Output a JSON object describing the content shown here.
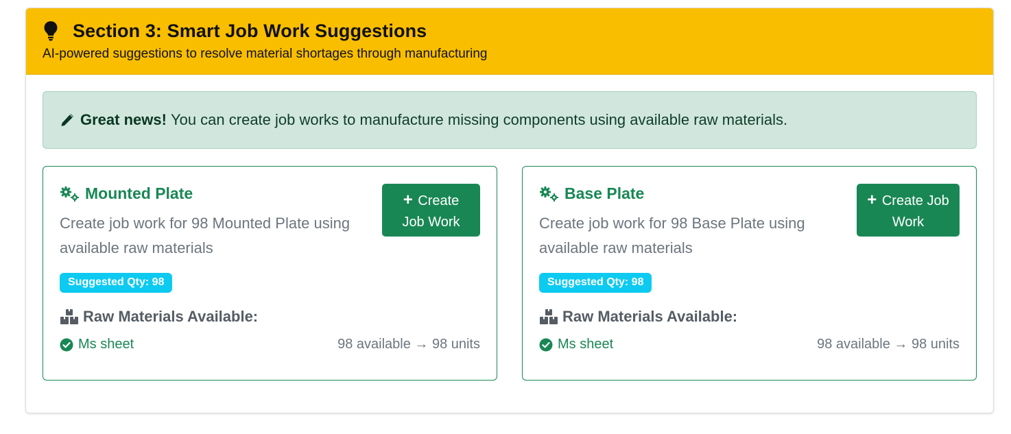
{
  "section": {
    "title": "Section 3: Smart Job Work Suggestions",
    "subtitle": "AI-powered suggestions to resolve material shortages through manufacturing",
    "icon": "lightbulb-icon",
    "header_color": "#f9be00"
  },
  "alert": {
    "strong": "Great news!",
    "message": "You can create job works to manufacture missing components using available raw materials.",
    "icon": "pencil-icon"
  },
  "cards": [
    {
      "title": "Mounted Plate",
      "description": "Create job work for 98 Mounted Plate using available raw materials",
      "button_plus": "+",
      "button_label": "Create Job Work",
      "badge": "Suggested Qty: 98",
      "raw_title": "Raw Materials Available:",
      "materials": [
        {
          "name": "Ms sheet",
          "qty": "98 available → 98 units"
        }
      ]
    },
    {
      "title": "Base Plate",
      "description": "Create job work for 98 Base Plate using available raw materials",
      "button_plus": "+",
      "button_label": "Create Job Work",
      "badge": "Suggested Qty: 98",
      "raw_title": "Raw Materials Available:",
      "materials": [
        {
          "name": "Ms sheet",
          "qty": "98 available → 98 units"
        }
      ]
    }
  ],
  "colors": {
    "success": "#198754",
    "info_badge": "#0dcaf0",
    "alert_bg": "#d1e7dd"
  }
}
